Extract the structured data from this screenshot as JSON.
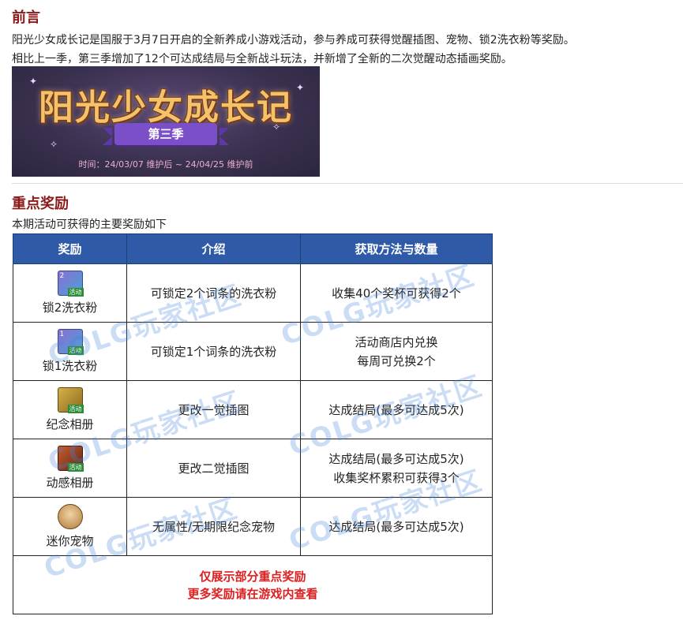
{
  "intro": {
    "heading": "前言",
    "paragraph_1": "阳光少女成长记是国服于3月7日开启的全新养成小游戏活动，参与养成可获得觉醒插图、宠物、锁2洗衣粉等奖励。",
    "paragraph_2": "相比上一季，第三季增加了12个可达成结局与全新战斗玩法，并新增了全新的二次觉醒动态插画奖励。"
  },
  "banner": {
    "title": "阳光少女成长记",
    "season": "第三季",
    "time": "时间：24/03/07 维护后 ~ 24/04/25 维护前"
  },
  "rewards_section": {
    "heading": "重点奖励",
    "subtitle": "本期活动可获得的主要奖励如下",
    "columns": [
      "奖励",
      "介绍",
      "获取方法与数量"
    ],
    "rows": [
      {
        "icon": "lock-card-icon",
        "icon_label": "2",
        "tag": "活动",
        "name": "锁2洗衣粉",
        "intro": "可锁定2个词条的洗衣粉",
        "method": [
          "收集40个奖杯可获得2个"
        ]
      },
      {
        "icon": "lock-card-icon",
        "icon_label": "1",
        "tag": "活动",
        "name": "锁1洗衣粉",
        "intro": "可锁定1个词条的洗衣粉",
        "method": [
          "活动商店内兑换",
          "每周可兑换2个"
        ]
      },
      {
        "icon": "album-icon",
        "icon_label": "",
        "tag": "活动",
        "name": "纪念相册",
        "intro": "更改一觉插图",
        "method": [
          "达成结局(最多可达成5次)"
        ]
      },
      {
        "icon": "dynamic-album-icon",
        "icon_label": "",
        "tag": "活动",
        "name": "动感相册",
        "intro": "更改二觉插图",
        "method": [
          "达成结局(最多可达成5次)",
          "收集奖杯累积可获得3个"
        ]
      },
      {
        "icon": "pet-icon",
        "icon_label": "",
        "tag": "",
        "name": "迷你宠物",
        "intro": "无属性/无期限纪念宠物",
        "method": [
          "达成结局(最多可达成5次)"
        ]
      }
    ],
    "footer_line_1": "仅展示部分重点奖励",
    "footer_line_2": "更多奖励请在游戏内查看"
  },
  "watermark": "COLG玩家社区",
  "colors": {
    "heading": "#8b1a1a",
    "table_header": "#2f5aa8",
    "footer_text": "#e02020"
  }
}
